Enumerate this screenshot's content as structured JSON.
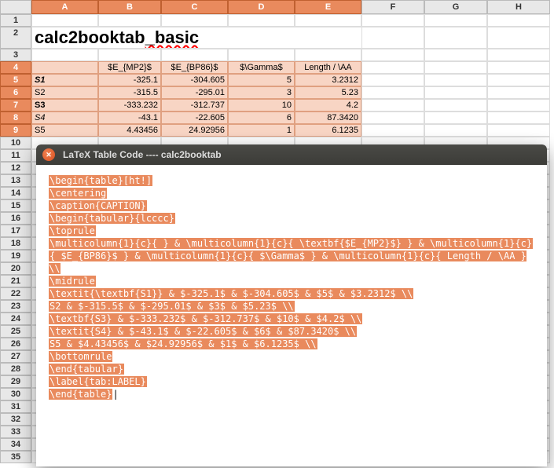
{
  "columns": [
    "A",
    "B",
    "C",
    "D",
    "E",
    "F",
    "G",
    "H"
  ],
  "selected_cols": [
    "A",
    "B",
    "C",
    "D",
    "E"
  ],
  "rows": [
    1,
    2,
    3,
    4,
    5,
    6,
    7,
    8,
    9,
    10,
    11,
    12,
    13,
    14,
    15,
    16,
    17,
    18,
    19,
    20,
    21,
    22,
    23,
    24,
    25,
    26,
    27,
    28,
    29,
    30,
    31,
    32,
    33,
    34,
    35
  ],
  "selected_rows": [
    4,
    5,
    6,
    7,
    8,
    9
  ],
  "title_cell": {
    "part1": "calc2booktab",
    "part2": "_basic"
  },
  "table": {
    "headers": [
      "",
      "$E_{MP2}$",
      "$E_{BP86}$",
      "$\\Gamma$",
      "Length / \\AA"
    ],
    "rows": [
      {
        "label": "S1",
        "bold": true,
        "italic": true,
        "v": [
          "-325.1",
          "-304.605",
          "5",
          "3.2312"
        ]
      },
      {
        "label": "S2",
        "bold": false,
        "italic": false,
        "v": [
          "-315.5",
          "-295.01",
          "3",
          "5.23"
        ]
      },
      {
        "label": "S3",
        "bold": true,
        "italic": false,
        "v": [
          "-333.232",
          "-312.737",
          "10",
          "4.2"
        ]
      },
      {
        "label": "S4",
        "bold": false,
        "italic": true,
        "v": [
          "-43.1",
          "-22.605",
          "6",
          "87.3420"
        ]
      },
      {
        "label": "S5",
        "bold": false,
        "italic": false,
        "v": [
          "4.43456",
          "24.92956",
          "1",
          "6.1235"
        ]
      }
    ]
  },
  "dialog": {
    "title": "LaTeX Table Code ---- calc2booktab",
    "lines": [
      "\\begin{table}[ht!]",
      "\\centering",
      "\\caption{CAPTION}",
      "\\begin{tabular}{lcccc}",
      "\\toprule",
      "\\multicolumn{1}{c}{ } & \\multicolumn{1}{c}{ \\textbf{$E_{MP2}$} } & \\multicolumn{1}{c}",
      "{ $E_{BP86}$ } & \\multicolumn{1}{c}{ $\\Gamma$ } & \\multicolumn{1}{c}{ Length / \\AA } \\\\",
      "\\midrule",
      "\\textit{\\textbf{S1}} & $-325.1$ & $-304.605$ & $5$ & $3.2312$ \\\\",
      "S2 & $-315.5$ & $-295.01$ & $3$ & $5.23$ \\\\",
      "\\textbf{S3} & $-333.232$ & $-312.737$ & $10$ & $4.2$ \\\\",
      "\\textit{S4} & $-43.1$ & $-22.605$ & $6$ & $87.3420$ \\\\",
      "S5 & $4.43456$ & $24.92956$ & $1$ & $6.1235$ \\\\",
      "\\bottomrule",
      "\\end{tabular}",
      "\\label{tab:LABEL}",
      "\\end{table}"
    ]
  }
}
